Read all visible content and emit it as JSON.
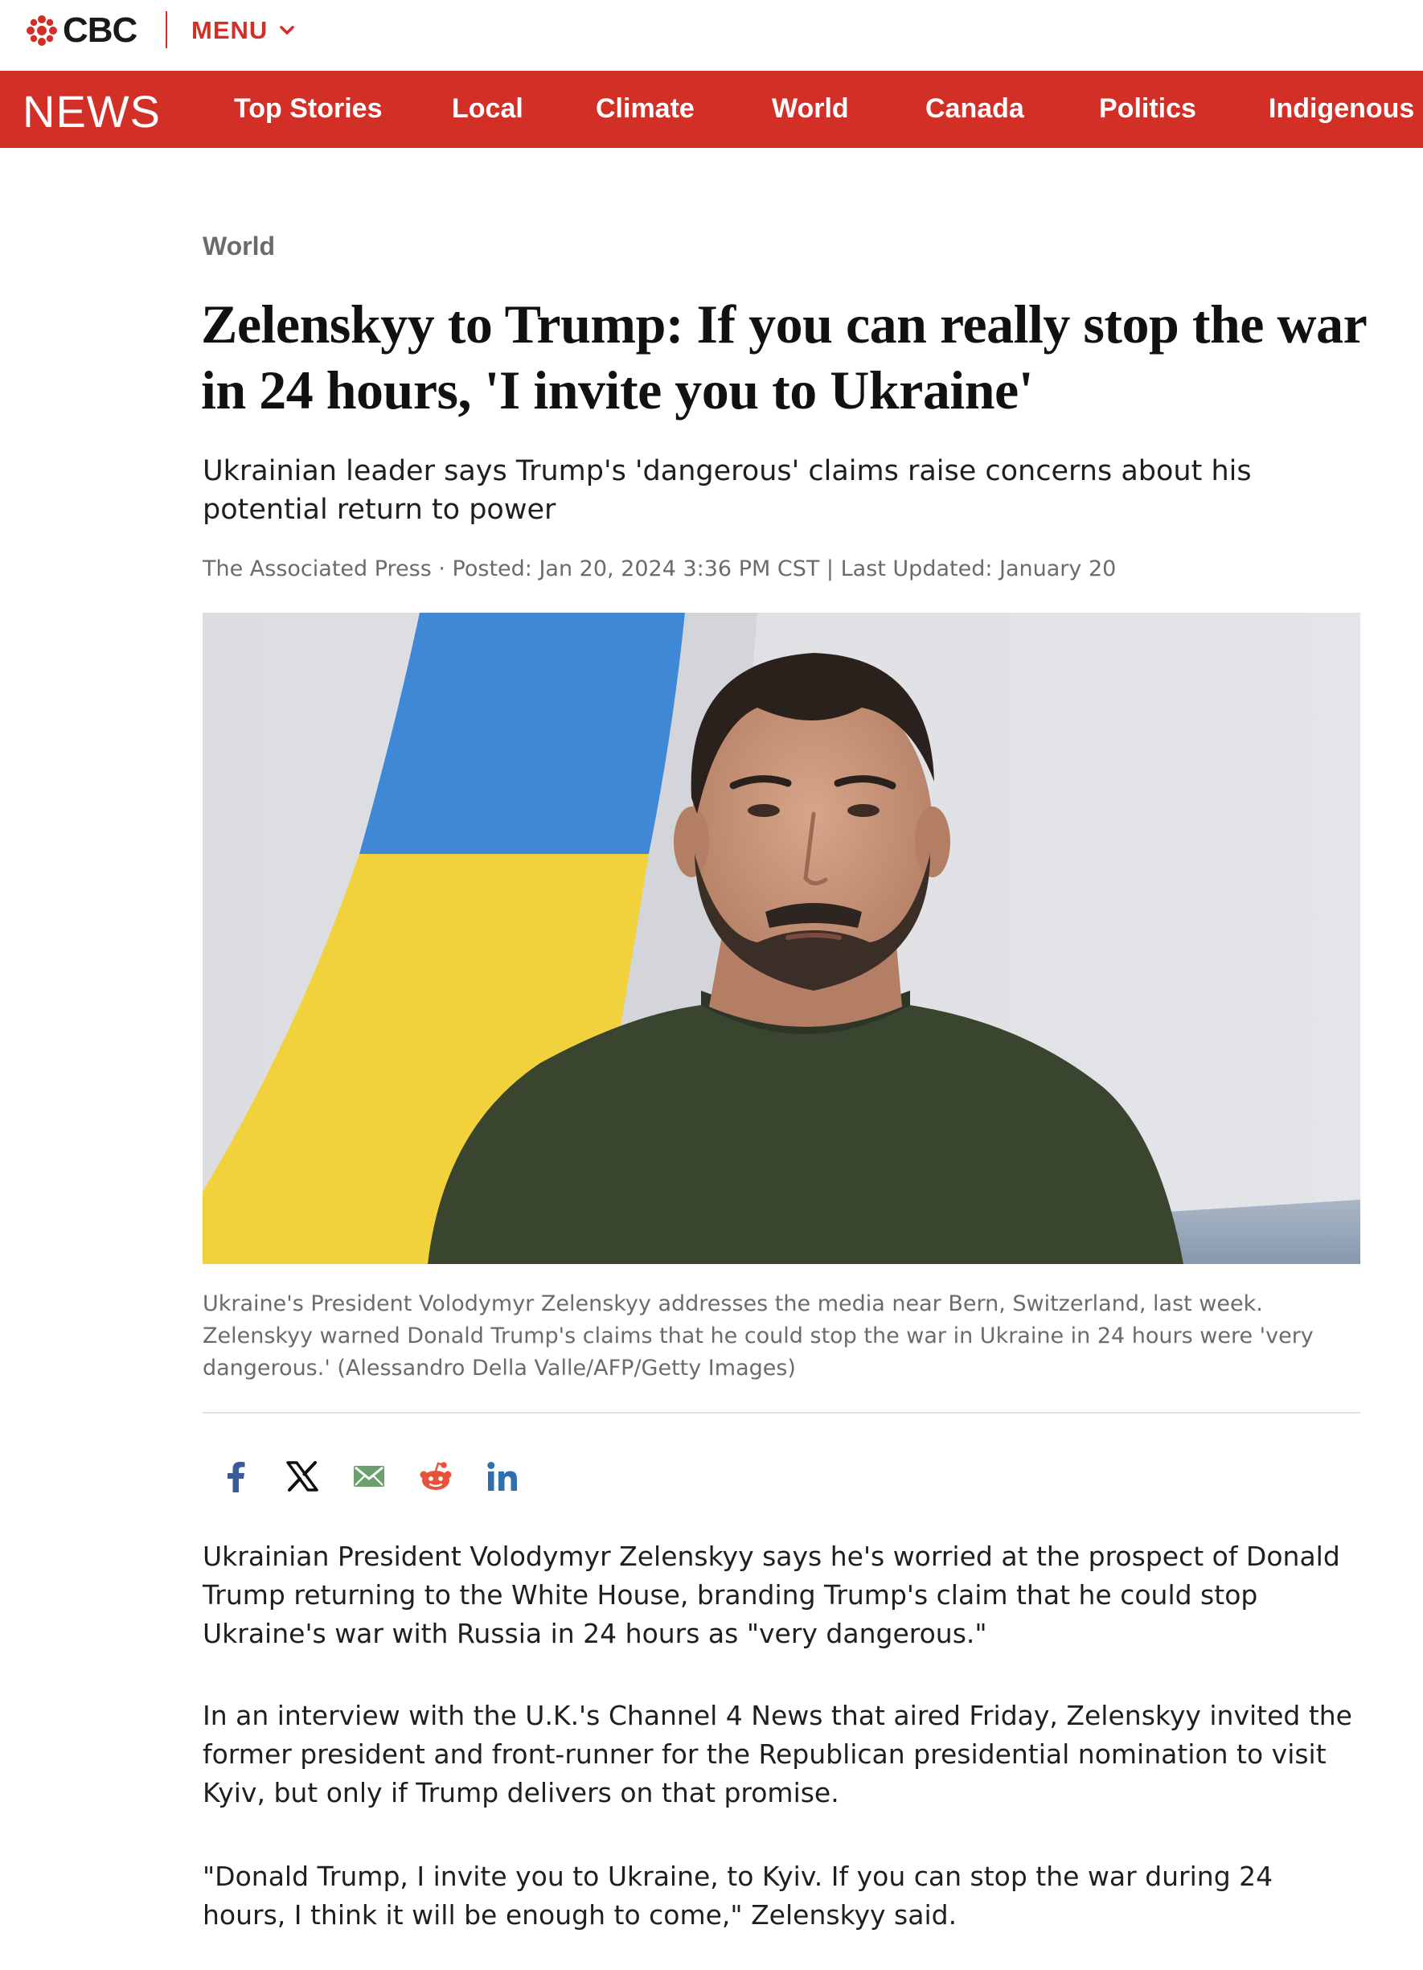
{
  "header": {
    "logo_text": "CBC",
    "menu_label": "MENU",
    "brand_color": "#d22f27"
  },
  "nav": {
    "section_label": "NEWS",
    "items": [
      {
        "label": "Top Stories"
      },
      {
        "label": "Local"
      },
      {
        "label": "Climate"
      },
      {
        "label": "World"
      },
      {
        "label": "Canada"
      },
      {
        "label": "Politics"
      },
      {
        "label": "Indigenous"
      }
    ]
  },
  "article": {
    "section": "World",
    "headline": "Zelenskyy to Trump: If you can really stop the war in 24 hours, 'I invite you to Ukraine'",
    "deck": "Ukrainian leader says Trump's 'dangerous' claims raise concerns about his potential return to power",
    "byline": "The Associated Press · Posted: Jan 20, 2024 3:36 PM CST | Last Updated: January 20",
    "image_caption": "Ukraine's President Volodymyr Zelenskyy addresses the media near Bern, Switzerland, last week. Zelenskyy warned Donald Trump's claims that he could stop the war in Ukraine in 24 hours were 'very dangerous.' (Alessandro Della Valle/AFP/Getty Images)",
    "share_icons": [
      "facebook-icon",
      "x-icon",
      "email-icon",
      "reddit-icon",
      "linkedin-icon"
    ],
    "paragraphs": [
      "Ukrainian President Volodymyr Zelenskyy says he's worried at the prospect of Donald Trump returning to the White House, branding Trump's claim that he could stop Ukraine's war with Russia in 24 hours as \"very dangerous.\"",
      "In an interview with the U.K.'s Channel 4 News that aired Friday, Zelenskyy invited the former president and front-runner for the Republican presidential nomination to visit Kyiv, but only if Trump delivers on that promise.",
      "\"Donald Trump, I invite you to Ukraine, to Kyiv. If you can stop the war during 24 hours, I think it will be enough to come,\" Zelenskyy said."
    ]
  }
}
